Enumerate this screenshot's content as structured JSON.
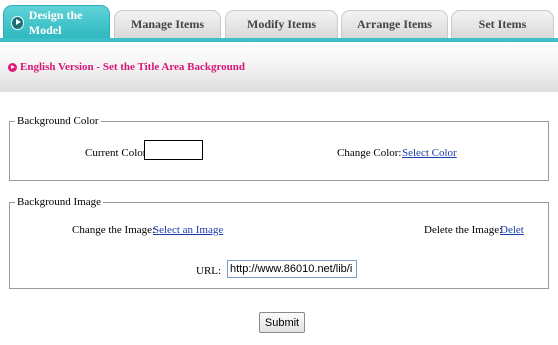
{
  "tabs": [
    {
      "label": "Design the Model",
      "active": true
    },
    {
      "label": "Manage Items",
      "active": false
    },
    {
      "label": "Modify Items",
      "active": false
    },
    {
      "label": "Arrange Items",
      "active": false
    },
    {
      "label": "Set Items",
      "active": false
    }
  ],
  "title_area": {
    "text": "English Version - Set the Title Area Background",
    "icon": "play-circle-icon"
  },
  "background_color": {
    "legend": "Background Color",
    "current_color_label": "Current Color:",
    "current_color_value": "#ffffff",
    "change_color_label": "Change Color:",
    "select_color_link": "Select Color"
  },
  "background_image": {
    "legend": "Background Image",
    "change_image_label": "Change the Image:",
    "select_image_link": "Select an Image",
    "delete_image_label": "Delete the Image:",
    "delete_link": "Delet",
    "url_label": "URL:",
    "url_value": "http://www.86010.net/lib/i"
  },
  "submit_label": "Submit",
  "colors": {
    "accent": "#3cbfc6",
    "title_pink": "#d8167a",
    "link_blue": "#1a3ea8"
  }
}
